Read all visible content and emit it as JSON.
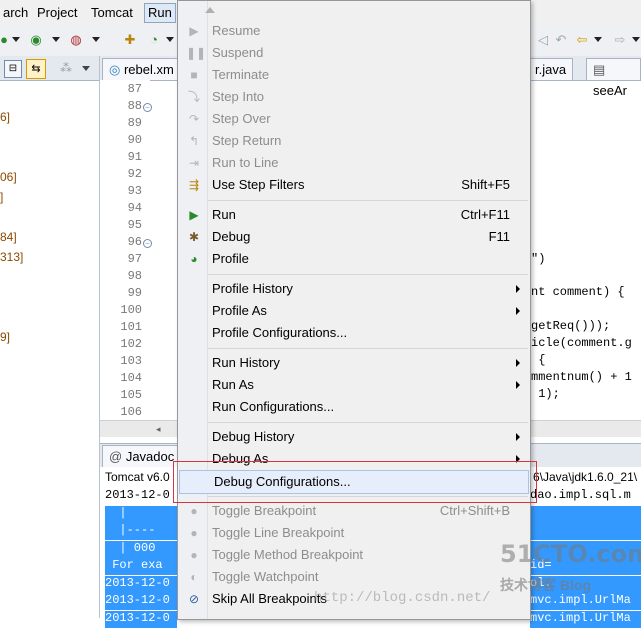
{
  "menubar": {
    "items": [
      "arch",
      "Project",
      "Tomcat",
      "Run"
    ]
  },
  "left_panel": {
    "lines": [
      "6]",
      "06]",
      "]",
      "84]",
      "313]",
      "9]"
    ]
  },
  "editor": {
    "tabs": [
      "rebel.xm",
      "r.java",
      "seeAr"
    ],
    "line_numbers": [
      "87",
      "88",
      "89",
      "90",
      "91",
      "92",
      "93",
      "94",
      "95",
      "96",
      "97",
      "98",
      "99",
      "100",
      "101",
      "102",
      "103",
      "104",
      "105",
      "106"
    ],
    "code_fragments": [
      "\")",
      "nt comment) {",
      "getReq()));",
      "icle(comment.g",
      " {",
      "mmentnum() + 1",
      " 1);"
    ]
  },
  "lower": {
    "tab": "Javadoc",
    "console_head_left": "Tomcat v6.0",
    "console_head_right": "6\\Java\\jdk1.6.0_21\\",
    "lines": [
      {
        "left": "2013-12-0",
        "right": "dao.impl.sql.m"
      },
      {
        "left": "  |",
        "right": ""
      },
      {
        "left": "  |----",
        "right": ""
      },
      {
        "left": "  | 000",
        "right": ""
      },
      {
        "left": " For exa",
        "right": "id="
      },
      {
        "left": "2013-12-0",
        "right": "ol."
      },
      {
        "left": "2013-12-0",
        "right": "mvc.impl.UrlMa"
      },
      {
        "left": "2013-12-0",
        "right": "mvc.impl.UrlMa"
      }
    ]
  },
  "run_menu": {
    "items": [
      {
        "label": "Resume",
        "accel": "",
        "submenu": false,
        "enabled": false,
        "icon": "resume-icon"
      },
      {
        "label": "Suspend",
        "accel": "",
        "submenu": false,
        "enabled": false,
        "icon": "suspend-icon"
      },
      {
        "label": "Terminate",
        "accel": "",
        "submenu": false,
        "enabled": false,
        "icon": "terminate-icon"
      },
      {
        "label": "Step Into",
        "accel": "",
        "submenu": false,
        "enabled": false,
        "icon": "step-into-icon"
      },
      {
        "label": "Step Over",
        "accel": "",
        "submenu": false,
        "enabled": false,
        "icon": "step-over-icon"
      },
      {
        "label": "Step Return",
        "accel": "",
        "submenu": false,
        "enabled": false,
        "icon": "step-return-icon"
      },
      {
        "label": "Run to Line",
        "accel": "",
        "submenu": false,
        "enabled": false,
        "icon": "run-to-line-icon"
      },
      {
        "label": "Use Step Filters",
        "accel": "Shift+F5",
        "submenu": false,
        "enabled": true,
        "icon": "step-filters-icon"
      },
      {
        "label": "Run",
        "accel": "Ctrl+F11",
        "submenu": false,
        "enabled": true,
        "icon": "run-icon"
      },
      {
        "label": "Debug",
        "accel": "F11",
        "submenu": false,
        "enabled": true,
        "icon": "debug-icon"
      },
      {
        "label": "Profile",
        "accel": "",
        "submenu": false,
        "enabled": true,
        "icon": "profile-icon"
      },
      {
        "label": "Profile History",
        "accel": "",
        "submenu": true,
        "enabled": true,
        "icon": ""
      },
      {
        "label": "Profile As",
        "accel": "",
        "submenu": true,
        "enabled": true,
        "icon": ""
      },
      {
        "label": "Profile Configurations...",
        "accel": "",
        "submenu": false,
        "enabled": true,
        "icon": ""
      },
      {
        "label": "Run History",
        "accel": "",
        "submenu": true,
        "enabled": true,
        "icon": ""
      },
      {
        "label": "Run As",
        "accel": "",
        "submenu": true,
        "enabled": true,
        "icon": ""
      },
      {
        "label": "Run Configurations...",
        "accel": "",
        "submenu": false,
        "enabled": true,
        "icon": ""
      },
      {
        "label": "Debug History",
        "accel": "",
        "submenu": true,
        "enabled": true,
        "icon": ""
      },
      {
        "label": "Debug As",
        "accel": "",
        "submenu": true,
        "enabled": true,
        "icon": ""
      },
      {
        "label": "Debug Configurations...",
        "accel": "",
        "submenu": false,
        "enabled": true,
        "icon": ""
      },
      {
        "label": "Toggle Breakpoint",
        "accel": "Ctrl+Shift+B",
        "submenu": false,
        "enabled": false,
        "icon": "breakpoint-icon"
      },
      {
        "label": "Toggle Line Breakpoint",
        "accel": "",
        "submenu": false,
        "enabled": false,
        "icon": "line-breakpoint-icon"
      },
      {
        "label": "Toggle Method Breakpoint",
        "accel": "",
        "submenu": false,
        "enabled": false,
        "icon": "method-breakpoint-icon"
      },
      {
        "label": "Toggle Watchpoint",
        "accel": "",
        "submenu": false,
        "enabled": false,
        "icon": "watchpoint-icon"
      },
      {
        "label": "Skip All Breakpoints",
        "accel": "",
        "submenu": false,
        "enabled": true,
        "icon": "skip-breakpoints-icon"
      }
    ]
  },
  "watermark": {
    "logo": "51CTO.com",
    "sub": "技术博客  Blog",
    "url": "http://blog.csdn.net/"
  },
  "colors": {
    "selection": "#3399ff",
    "highlight_box": "#d9343c",
    "menu_bg": "#f0f0f0"
  }
}
